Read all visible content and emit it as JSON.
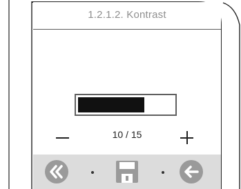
{
  "header": {
    "title": "1.2.1.2.  Kontrast"
  },
  "contrast": {
    "display": "10 / 15",
    "value": 10,
    "max": 15
  },
  "toolbar": {
    "buttons": [
      {
        "icon": "double-chevron-left-icon"
      },
      {
        "icon": "floppy-save-icon"
      },
      {
        "icon": "arrow-left-icon"
      }
    ]
  },
  "colors": {
    "toolbar_background": "#dcdcdc",
    "toolbar_icon": "#9a9a9a",
    "title_text": "#8f8f8f",
    "bar_fill": "#111111"
  }
}
